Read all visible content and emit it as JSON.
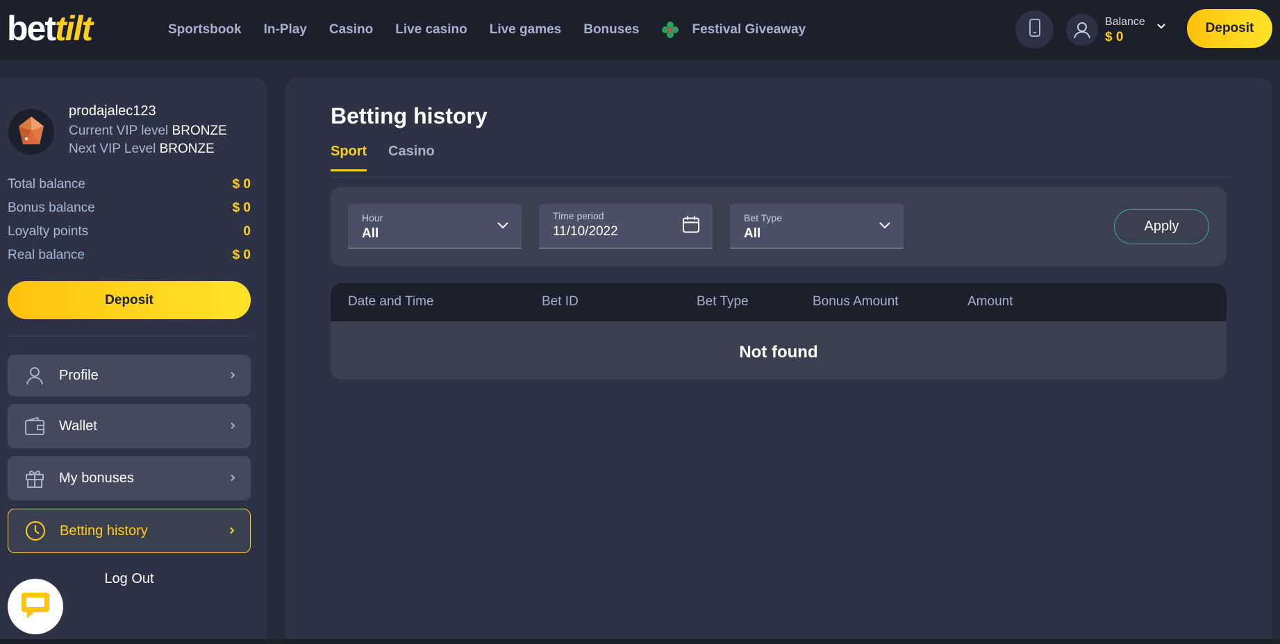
{
  "brand": {
    "part1": "bet",
    "part2": "tilt"
  },
  "nav": {
    "items": [
      "Sportsbook",
      "In-Play",
      "Casino",
      "Live casino",
      "Live games",
      "Bonuses"
    ],
    "festival": "Festival Giveaway"
  },
  "header": {
    "balance_label": "Balance",
    "balance_value": "$ 0",
    "deposit_label": "Deposit"
  },
  "sidebar": {
    "username": "prodajalec123",
    "vip_current_label": "Current VIP level",
    "vip_current_value": "BRONZE",
    "vip_next_label": "Next VIP Level",
    "vip_next_value": "BRONZE",
    "stats": [
      {
        "label": "Total balance",
        "value": "$ 0"
      },
      {
        "label": "Bonus balance",
        "value": "$ 0"
      },
      {
        "label": "Loyalty points",
        "value": "0"
      },
      {
        "label": "Real balance",
        "value": "$ 0"
      }
    ],
    "deposit_label": "Deposit",
    "menu": [
      {
        "label": "Profile",
        "icon": "user-icon"
      },
      {
        "label": "Wallet",
        "icon": "wallet-icon"
      },
      {
        "label": "My bonuses",
        "icon": "gift-icon"
      },
      {
        "label": "Betting history",
        "icon": "clock-icon",
        "active": true
      }
    ],
    "logout_label": "Log Out"
  },
  "main": {
    "title": "Betting history",
    "tabs": [
      {
        "label": "Sport",
        "active": true
      },
      {
        "label": "Casino",
        "active": false
      }
    ],
    "filters": {
      "hour_label": "Hour",
      "hour_value": "All",
      "period_label": "Time period",
      "period_value": "11/10/2022",
      "bettype_label": "Bet Type",
      "bettype_value": "All",
      "apply_label": "Apply"
    },
    "table": {
      "columns": [
        "Date and Time",
        "Bet ID",
        "Bet Type",
        "Bonus Amount",
        "Amount"
      ],
      "empty_message": "Not found"
    }
  },
  "colors": {
    "accent": "#ffce1f",
    "header_bg": "#1c202c",
    "panel_bg": "#2d3344",
    "apply_border": "#3fae96"
  }
}
